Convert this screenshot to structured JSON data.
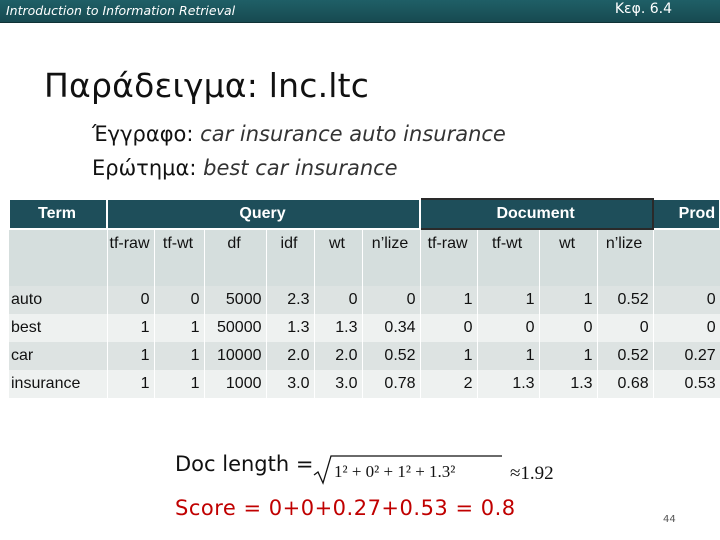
{
  "header": {
    "course": "Introduction to Information Retrieval",
    "chapter": "Κεφ. 6.4"
  },
  "slide": {
    "title": "Παράδειγμα: lnc.ltc",
    "document_label": "Έγγραφο:",
    "document_text": "car insurance auto insurance",
    "query_label": "Ερώτημα:",
    "query_text": "best car insurance"
  },
  "table": {
    "group_headers": {
      "term": "Term",
      "query": "Query",
      "document": "Document",
      "prod": "Prod"
    },
    "sub_headers": [
      "tf-raw",
      "tf-wt",
      "df",
      "idf",
      "wt",
      "n’lize",
      "tf-raw",
      "tf-wt",
      "wt",
      "n’lize"
    ],
    "rows": [
      [
        "auto",
        "0",
        "0",
        "5000",
        "2.3",
        "0",
        "0",
        "1",
        "1",
        "1",
        "0.52",
        "0"
      ],
      [
        "best",
        "1",
        "1",
        "50000",
        "1.3",
        "1.3",
        "0.34",
        "0",
        "0",
        "0",
        "0",
        "0"
      ],
      [
        "car",
        "1",
        "1",
        "10000",
        "2.0",
        "2.0",
        "0.52",
        "1",
        "1",
        "1",
        "0.52",
        "0.27"
      ],
      [
        "insurance",
        "1",
        "1",
        "1000",
        "3.0",
        "3.0",
        "0.78",
        "2",
        "1.3",
        "1.3",
        "0.68",
        "0.53"
      ]
    ]
  },
  "footer": {
    "doc_length_label": "Doc length =",
    "formula_radicand": "1² + 0² + 1² + 1.3²",
    "formula_result": "≈1.92",
    "score": "Score = 0+0+0.27+0.53 = 0.8",
    "page_number": "44"
  }
}
